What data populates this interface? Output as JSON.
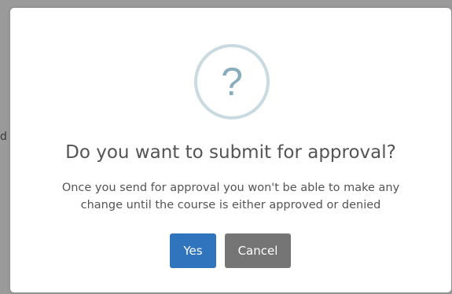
{
  "background": {
    "partial_text": "d"
  },
  "dialog": {
    "icon": {
      "name": "question-icon",
      "glyph": "?",
      "ring_color": "#c9dae1",
      "glyph_color": "#87adbd"
    },
    "title": "Do you want to submit for approval?",
    "message_line1": "Once you send for approval you won't be able to make any",
    "message_line2": "change until the course is either approved or denied",
    "buttons": {
      "confirm_label": "Yes",
      "confirm_color": "#2f74bc",
      "cancel_label": "Cancel",
      "cancel_color": "#757575"
    }
  }
}
